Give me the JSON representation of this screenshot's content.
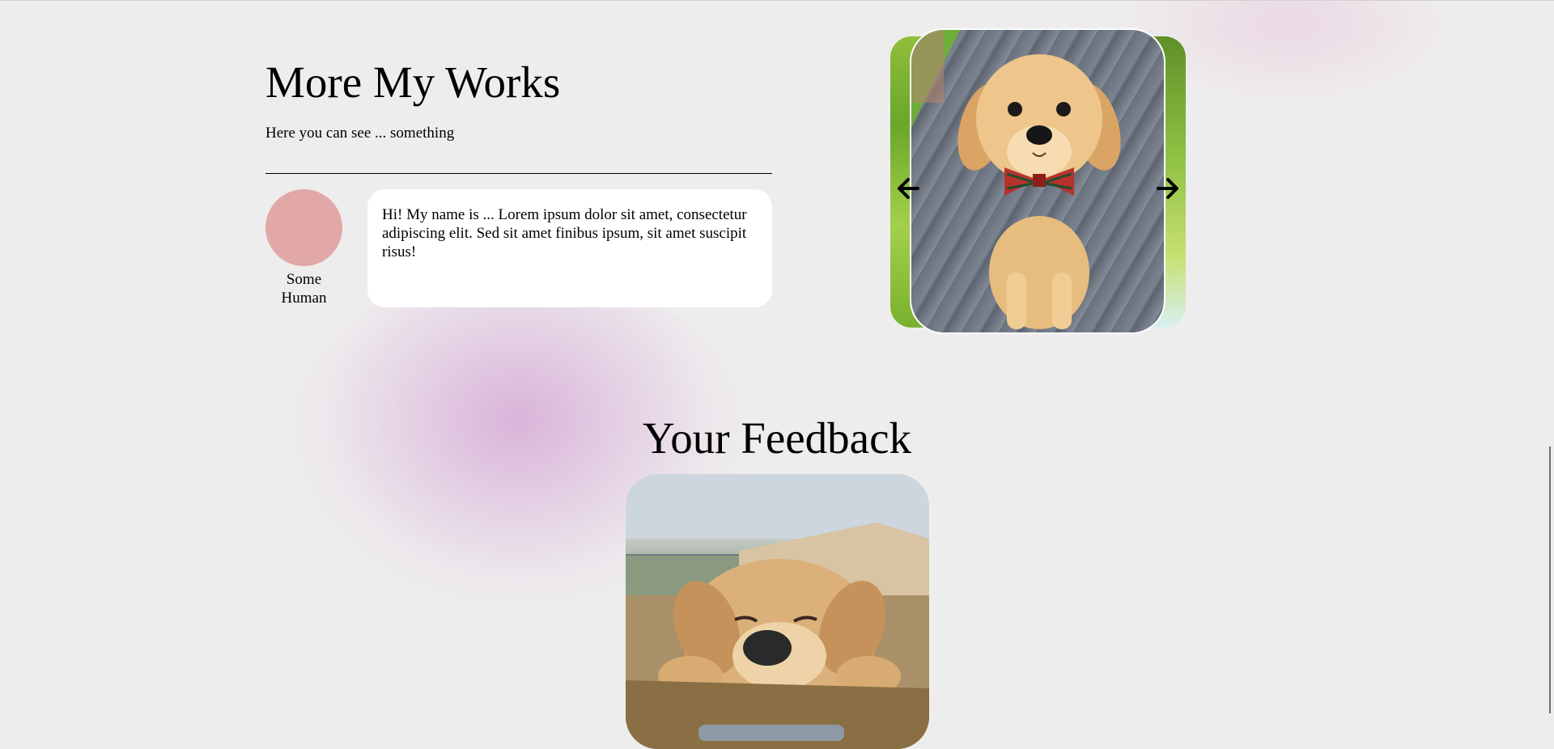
{
  "works": {
    "title": "More My Works",
    "subtitle": "Here you can see ... something",
    "review": {
      "name": "Some Human",
      "text": "Hi! My name is ... Lorem ipsum dolor sit amet, consectetur adipiscing elit. Sed sit amet finibus ipsum, sit amet suscipit risus!",
      "avatar_color": "#e2a8a8"
    },
    "carousel": {
      "prev_icon": "arrow-left-icon",
      "next_icon": "arrow-right-icon"
    }
  },
  "feedback": {
    "title": "Your Feedback"
  },
  "colors": {
    "background": "#eeeded",
    "bubble": "#ffffff",
    "blob": "#dcb4dc"
  }
}
